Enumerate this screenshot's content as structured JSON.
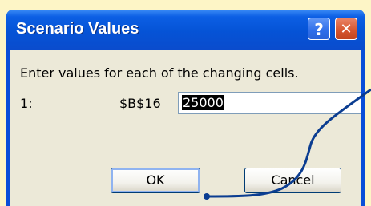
{
  "dialog": {
    "title": "Scenario Values",
    "help_label": "?",
    "close_label": "✕",
    "prompt": "Enter values for each of the changing cells.",
    "row": {
      "number_prefix": "1",
      "number_suffix": ":",
      "cell_ref": "$B$16",
      "value": "25000"
    },
    "ok_label": "OK",
    "cancel_label": "Cancel"
  },
  "colors": {
    "background": "#fdf5c6",
    "titlebar": "#0553d6",
    "client": "#ece9d8",
    "arrow": "#0b3d91"
  }
}
